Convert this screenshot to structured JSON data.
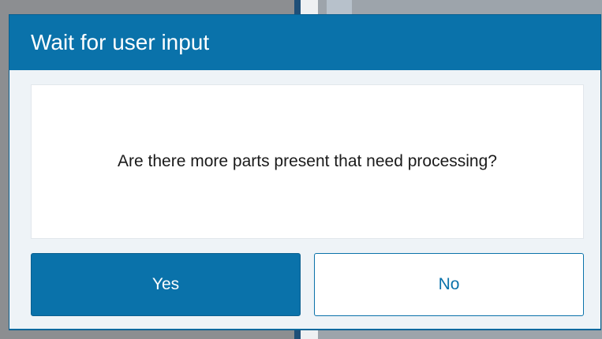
{
  "dialog": {
    "title": "Wait for user input",
    "message": "Are there more parts present that need processing?",
    "buttons": {
      "yes_label": "Yes",
      "no_label": "No"
    }
  },
  "colors": {
    "accent": "#0a72aa",
    "dialog_body": "#eef3f7",
    "message_text": "#1a1a1a"
  }
}
